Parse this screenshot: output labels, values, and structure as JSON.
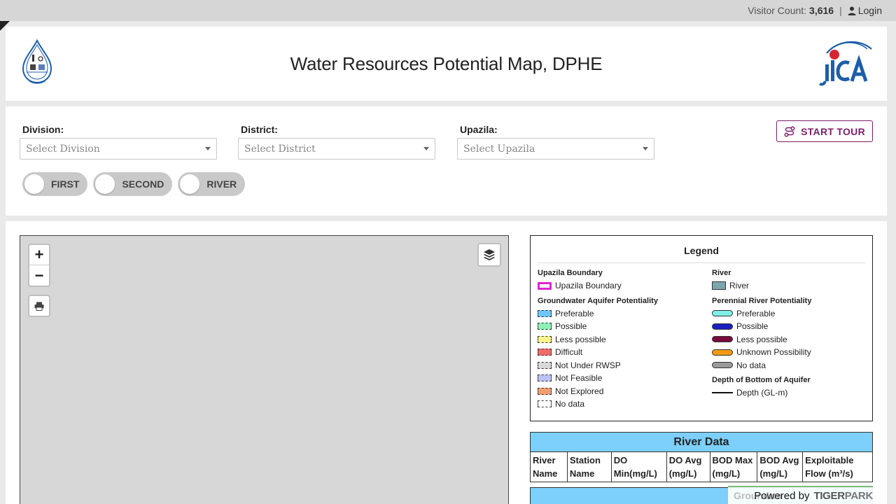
{
  "topbar": {
    "visitor_label": "Visitor Count:",
    "visitor_count": "3,616",
    "separator": "|",
    "login_label": "Login"
  },
  "header": {
    "title": "Water Resources Potential Map, DPHE"
  },
  "filters": {
    "division": {
      "label": "Division:",
      "placeholder": "Select Division"
    },
    "district": {
      "label": "District:",
      "placeholder": "Select District"
    },
    "upazila": {
      "label": "Upazila:",
      "placeholder": "Select Upazila"
    },
    "tour_label": "START TOUR",
    "toggles": [
      "FIRST",
      "SECOND",
      "RIVER"
    ]
  },
  "map": {
    "zoom_in": "+",
    "zoom_out": "−"
  },
  "legend": {
    "title": "Legend",
    "upazila_heading": "Upazila Boundary",
    "upazila_item": "Upazila Boundary",
    "gw_heading": "Groundwater Aquifer Potentiality",
    "gw_items": [
      {
        "label": "Preferable",
        "color": "#6ec6f5"
      },
      {
        "label": "Possible",
        "color": "#8ef0b8"
      },
      {
        "label": "Less possible",
        "color": "#fbf58a"
      },
      {
        "label": "Difficult",
        "color": "#f06b6b"
      },
      {
        "label": "Not Under RWSP",
        "color": "#d8d8d8"
      },
      {
        "label": "Not Feasible",
        "color": "#b9c2f5"
      },
      {
        "label": "Not Explored",
        "color": "#f0a070"
      },
      {
        "label": "No data",
        "color": "#ffffff"
      }
    ],
    "river_heading": "River",
    "river_item": "River",
    "river_color": "#7ba6ad",
    "perennial_heading": "Perennial River Potentiality",
    "perennial_items": [
      {
        "label": "Preferable",
        "color": "#7ff0e8"
      },
      {
        "label": "Possible",
        "color": "#1a1fc2"
      },
      {
        "label": "Less possible",
        "color": "#7a0a3c"
      },
      {
        "label": "Unknown Possibility",
        "color": "#f59a12"
      },
      {
        "label": "No data",
        "color": "#9a9a9a"
      }
    ],
    "depth_heading": "Depth of Bottom of Aquifer",
    "depth_item": "Depth (GL-m)"
  },
  "river_data": {
    "title": "River Data",
    "columns": [
      "River Name",
      "Station Name",
      "DO Min(mg/L)",
      "DO Avg (mg/L)",
      "BOD Max (mg/L)",
      "BOD Avg (mg/L)",
      "Exploitable Flow (m³/s)"
    ]
  },
  "footer": {
    "powered_by": "Powered by",
    "brand_a": "TIGER",
    "brand_b": "PARK",
    "ghost": "Groundwa"
  }
}
